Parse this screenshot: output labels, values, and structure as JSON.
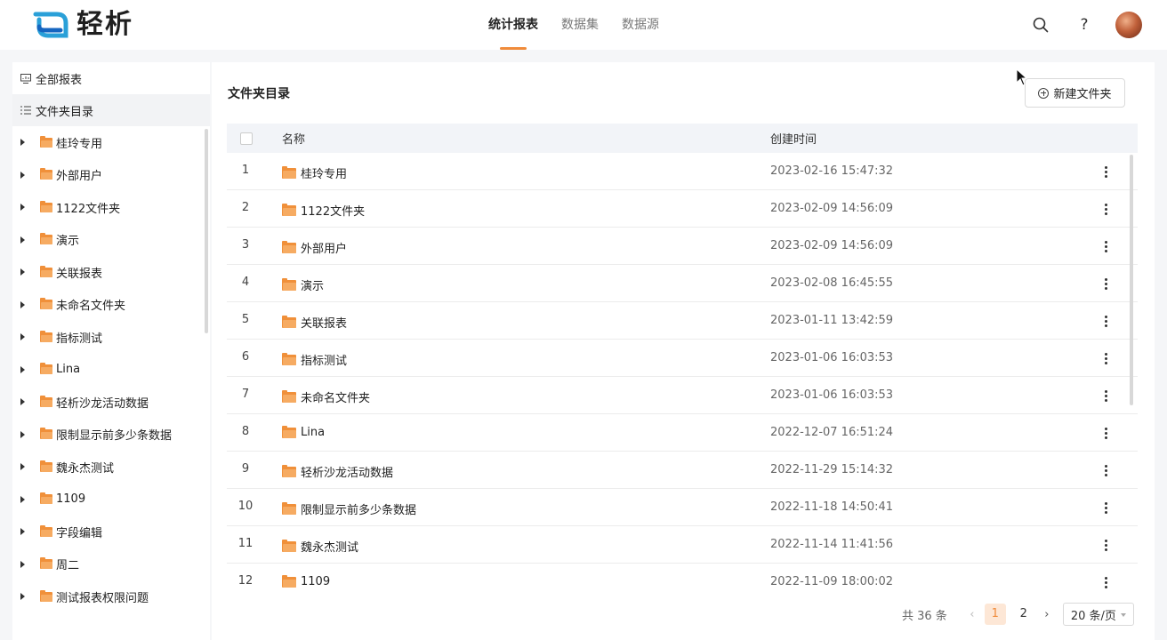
{
  "header": {
    "brand": "轻析",
    "tabs": [
      {
        "label": "统计报表",
        "active": true
      },
      {
        "label": "数据集",
        "active": false
      },
      {
        "label": "数据源",
        "active": false
      }
    ],
    "icons": [
      "search-icon",
      "help-icon",
      "avatar"
    ],
    "help_glyph": "?"
  },
  "sidebar": {
    "all_reports": "全部报表",
    "folder_dir": "文件夹目录",
    "items": [
      "桂玲专用",
      "外部用户",
      "1122文件夹",
      "演示",
      "关联报表",
      "未命名文件夹",
      "指标测试",
      "Lina",
      "轻析沙龙活动数据",
      "限制显示前多少条数据",
      "魏永杰测试",
      "1109",
      "字段编辑",
      "周二",
      "测试报表权限问题"
    ]
  },
  "main": {
    "title": "文件夹目录",
    "new_folder_button": "新建文件夹",
    "columns": {
      "name": "名称",
      "created": "创建时间"
    },
    "rows": [
      {
        "idx": "1",
        "name": "桂玲专用",
        "created": "2023-02-16 15:47:32"
      },
      {
        "idx": "2",
        "name": "1122文件夹",
        "created": "2023-02-09 14:56:09"
      },
      {
        "idx": "3",
        "name": "外部用户",
        "created": "2023-02-09 14:56:09"
      },
      {
        "idx": "4",
        "name": "演示",
        "created": "2023-02-08 16:45:55"
      },
      {
        "idx": "5",
        "name": "关联报表",
        "created": "2023-01-11 13:42:59"
      },
      {
        "idx": "6",
        "name": "指标测试",
        "created": "2023-01-06 16:03:53"
      },
      {
        "idx": "7",
        "name": "未命名文件夹",
        "created": "2023-01-06 16:03:53"
      },
      {
        "idx": "8",
        "name": "Lina",
        "created": "2022-12-07 16:51:24"
      },
      {
        "idx": "9",
        "name": "轻析沙龙活动数据",
        "created": "2022-11-29 15:14:32"
      },
      {
        "idx": "10",
        "name": "限制显示前多少条数据",
        "created": "2022-11-18 14:50:41"
      },
      {
        "idx": "11",
        "name": "魏永杰测试",
        "created": "2022-11-14 11:41:56"
      },
      {
        "idx": "12",
        "name": "1109",
        "created": "2022-11-09 18:00:02"
      }
    ]
  },
  "pagination": {
    "total": "共 36 条",
    "pages": [
      "1",
      "2"
    ],
    "current": "1",
    "page_size": "20 条/页"
  },
  "colors": {
    "accent": "#f08b3a",
    "folder": "#f0903a"
  }
}
